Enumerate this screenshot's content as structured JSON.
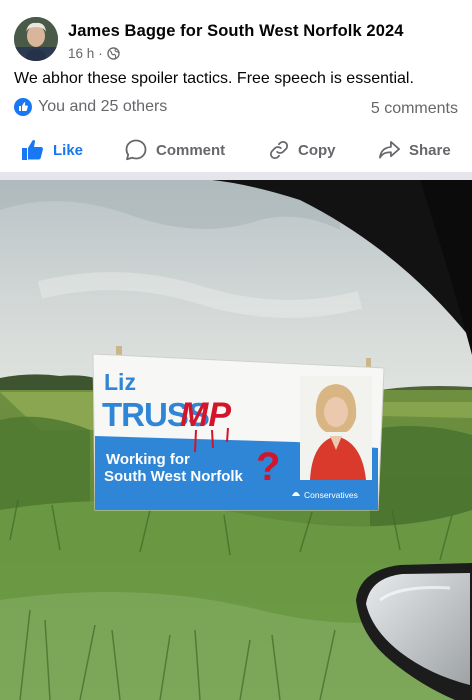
{
  "post": {
    "page_name": "James Bagge for South West Norfolk 2024",
    "time": "16 h",
    "dot": "·",
    "privacy_icon": "globe-icon",
    "text": "We abhor these spoiler tactics. Free speech is essential.",
    "reactions_text": "You and 25 others",
    "comments_text": "5 comments"
  },
  "actions": {
    "like": "Like",
    "comment": "Comment",
    "copy": "Copy",
    "share": "Share"
  },
  "photo": {
    "sign": {
      "line1": "Liz",
      "line2": "TRUSS",
      "graffiti": "MP",
      "graffiti_q": "?",
      "tagline1": "Working for",
      "tagline2": "South West Norfolk",
      "party": "Conservatives"
    }
  },
  "colors": {
    "like_blue": "#1877f2",
    "sign_blue": "#2f86d6",
    "graffiti_red": "#d4142a"
  }
}
